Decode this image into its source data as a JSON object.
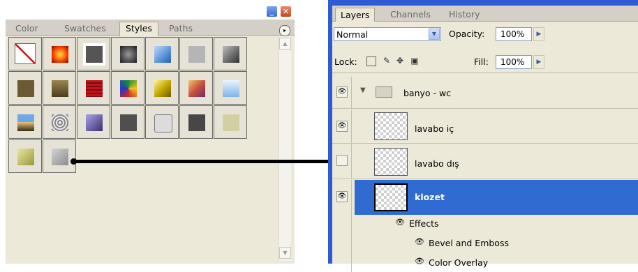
{
  "styles_panel": {
    "window_buttons": {
      "minimize": "_",
      "close": "✕"
    },
    "tabs": [
      {
        "label": "Color",
        "active": false
      },
      {
        "label": "Swatches",
        "active": false
      },
      {
        "label": "Styles",
        "active": true
      },
      {
        "label": "Paths",
        "active": false
      }
    ],
    "menu_button_icon": "▸",
    "scroll_up_icon": "▲",
    "scroll_down_icon": "▼",
    "styles": [
      {
        "name": "none",
        "fill": "#ffffff"
      },
      {
        "name": "red-glow",
        "fill": "radial-gradient(#ffe14a,#ff4a00 55%,#8a0000)"
      },
      {
        "name": "gray-outlined",
        "fill": "#555555"
      },
      {
        "name": "dark-round",
        "fill": "radial-gradient(#9a9a9a,#1a1a1a)"
      },
      {
        "name": "blue-glass",
        "fill": "linear-gradient(135deg,#b8dbff,#1d5fb8)"
      },
      {
        "name": "light-gray",
        "fill": "#b5b5b5"
      },
      {
        "name": "gray-gradient",
        "fill": "linear-gradient(135deg,#bdbdbd,#2f2f2f)"
      },
      {
        "name": "wood",
        "fill": "#6e5935"
      },
      {
        "name": "bronze",
        "fill": "linear-gradient(#9a8450,#4c3c1c)"
      },
      {
        "name": "red-stripes",
        "fill": "repeating-linear-gradient(#c2131a 0 3px,#7e0a12 3px 5px)"
      },
      {
        "name": "multicolor",
        "fill": "conic-gradient(#1c8e3a,#f2c11b,#d02828,#2236c8,#1c8e3a)"
      },
      {
        "name": "gold",
        "fill": "linear-gradient(135deg,#fff39a,#c7a800 50%,#6e5d00)"
      },
      {
        "name": "sunset",
        "fill": "linear-gradient(135deg,#f1c66e,#c8523d 50%,#6b2a6a)"
      },
      {
        "name": "sky",
        "fill": "linear-gradient(#e9f4ff,#7fb5e8)"
      },
      {
        "name": "landscape",
        "fill": "linear-gradient(#6ea8e6 45%,#e7c87c 45%,#3a2a10)"
      },
      {
        "name": "stone",
        "fill": "repeating-radial-gradient(#e8e8e8 0 2px,#8a8a8a 2px 4px)"
      },
      {
        "name": "purple-bevel",
        "fill": "linear-gradient(135deg,#a9a3e6,#3a3170)"
      },
      {
        "name": "dark-gray",
        "fill": "#4f4f4f"
      },
      {
        "name": "outline",
        "fill": "#dcdcdc"
      },
      {
        "name": "charcoal",
        "fill": "#474747"
      },
      {
        "name": "khaki",
        "fill": "#d2cfa2"
      },
      {
        "name": "olive-bevel",
        "fill": "linear-gradient(135deg,#e8e6a1,#9c9a3b)"
      },
      {
        "name": "gray-bevel-new",
        "fill": "linear-gradient(135deg,#d3d3d3,#8d8d8d)"
      }
    ]
  },
  "layers_panel": {
    "tabs": [
      {
        "label": "Layers",
        "active": true
      },
      {
        "label": "Channels",
        "active": false
      },
      {
        "label": "History",
        "active": false
      }
    ],
    "blend_mode": "Normal",
    "opacity_label": "Opacity:",
    "opacity_value": "100%",
    "lock_label": "Lock:",
    "fill_label": "Fill:",
    "fill_value": "100%",
    "spin_icon": "▶",
    "dropdown_icon": "▼",
    "eye_icon": "👁",
    "group": {
      "name": "banyo - wc",
      "expanded": true
    },
    "layers": [
      {
        "name": "lavabo iç",
        "visible": true,
        "selected": false
      },
      {
        "name": "lavabo dış",
        "visible": false,
        "selected": false
      },
      {
        "name": "klozet",
        "visible": true,
        "selected": true
      }
    ],
    "effects_label": "Effects",
    "effects": [
      "Bevel and Emboss",
      "Color Overlay"
    ]
  },
  "colors": {
    "selection": "#2f6bd0",
    "frame": "#2c5bd4",
    "panel_bg": "#ece9d8"
  }
}
